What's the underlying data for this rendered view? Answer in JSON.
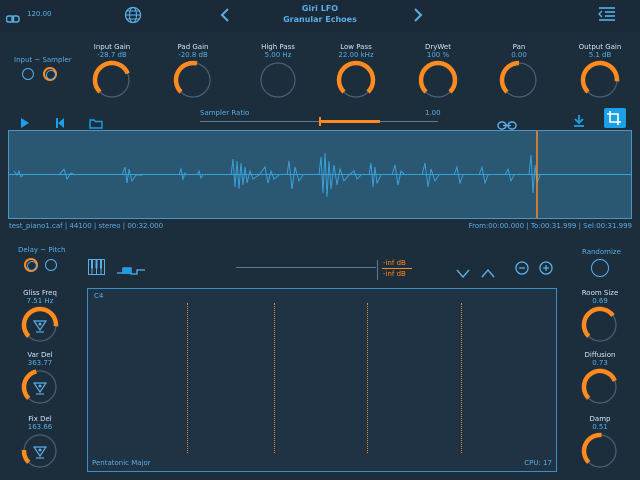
{
  "header": {
    "bpm": "120.00",
    "app_name": "Giri LFO",
    "preset_name": "Granular Echoes"
  },
  "input_mode": {
    "label": "Input ~ Sampler"
  },
  "knobs": [
    {
      "label": "Input Gain",
      "value": "-28.7 dB",
      "level": 0.75
    },
    {
      "label": "Pad Gain",
      "value": "-20.8 dB",
      "level": 0.55
    },
    {
      "label": "High Pass",
      "value": "5.00 Hz",
      "level": 0.0
    },
    {
      "label": "Low Pass",
      "value": "22.00 kHz",
      "level": 1.0
    },
    {
      "label": "DryWet",
      "value": "100 %",
      "level": 1.0
    },
    {
      "label": "Pan",
      "value": "0.00",
      "level": 0.5
    },
    {
      "label": "Output Gain",
      "value": "5.1 dB",
      "level": 0.85
    }
  ],
  "sampler": {
    "ratio_label": "Sampler Ratio",
    "ratio_value": "1.00",
    "ratio_fraction": 0.45
  },
  "file_info": {
    "left": "test_piano1.caf | 44100 | stereo | 00:32.000",
    "right": "From:00:00.000 | To:00:31.999 | Sel:00:31.999"
  },
  "delay_mode": {
    "label": "Delay ~ Pitch"
  },
  "left_knobs": [
    {
      "label": "Gliss Freq",
      "value": "7.51 Hz",
      "level": 0.85
    },
    {
      "label": "Var Del",
      "value": "363.77",
      "level": 0.45
    },
    {
      "label": "Fix Del",
      "value": "163.66",
      "level": 0.18
    }
  ],
  "right_knobs": [
    {
      "label": "Room Size",
      "value": "0.69",
      "level": 0.7
    },
    {
      "label": "Diffusion",
      "value": "0.73",
      "level": 0.75
    },
    {
      "label": "Damp",
      "value": "0.51",
      "level": 0.52
    }
  ],
  "meters": {
    "top": "-inf dB",
    "bottom": "-inf dB"
  },
  "randomize": {
    "label": "Randomize"
  },
  "panel": {
    "note": "C4",
    "scale": "Pentatonic Major",
    "cpu": "CPU: 17"
  },
  "colors": {
    "accent": "#ff8a1f",
    "blue": "#1aa0e6",
    "text": "#5aaee6"
  }
}
